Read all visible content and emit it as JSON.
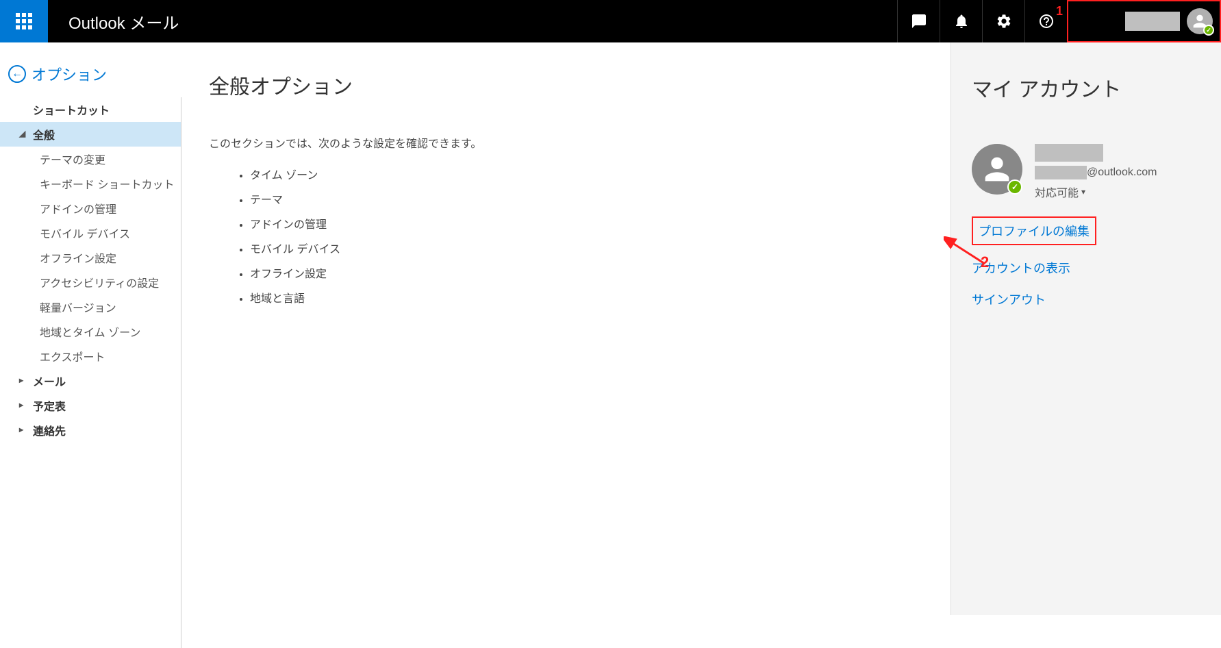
{
  "header": {
    "app_title": "Outlook メール"
  },
  "annotations": {
    "label1": "1",
    "label2": "2"
  },
  "leftnav": {
    "back_label": "オプション",
    "items": [
      {
        "label": "ショートカット",
        "type": "bold"
      },
      {
        "label": "全般",
        "type": "bold-expanded-selected"
      },
      {
        "label": "テーマの変更",
        "type": "sub"
      },
      {
        "label": "キーボード ショートカット",
        "type": "sub"
      },
      {
        "label": "アドインの管理",
        "type": "sub"
      },
      {
        "label": "モバイル デバイス",
        "type": "sub"
      },
      {
        "label": "オフライン設定",
        "type": "sub"
      },
      {
        "label": "アクセシビリティの設定",
        "type": "sub"
      },
      {
        "label": "軽量バージョン",
        "type": "sub"
      },
      {
        "label": "地域とタイム ゾーン",
        "type": "sub"
      },
      {
        "label": "エクスポート",
        "type": "sub"
      },
      {
        "label": "メール",
        "type": "bold-collapsed"
      },
      {
        "label": "予定表",
        "type": "bold-collapsed"
      },
      {
        "label": "連絡先",
        "type": "bold-collapsed"
      }
    ]
  },
  "main": {
    "title": "全般オプション",
    "description": "このセクションでは、次のような設定を確認できます。",
    "bullets": [
      "タイム ゾーン",
      "テーマ",
      "アドインの管理",
      "モバイル デバイス",
      "オフライン設定",
      "地域と言語"
    ]
  },
  "rightpanel": {
    "title": "マイ アカウント",
    "email_suffix": "@outlook.com",
    "status": "対応可能",
    "links": {
      "edit_profile": "プロファイルの編集",
      "view_account": "アカウントの表示",
      "sign_out": "サインアウト"
    }
  }
}
